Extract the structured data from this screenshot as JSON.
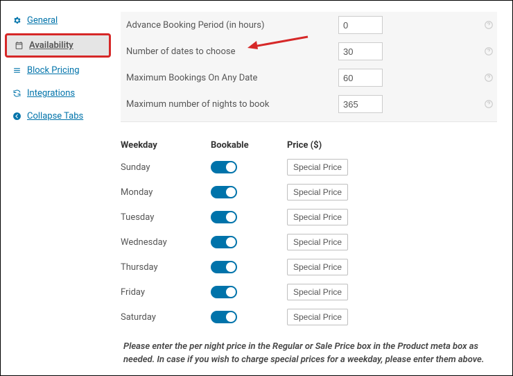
{
  "sidebar": {
    "items": [
      {
        "label": "General",
        "icon": "gear"
      },
      {
        "label": "Availability",
        "icon": "calendar"
      },
      {
        "label": "Block Pricing",
        "icon": "list"
      },
      {
        "label": "Integrations",
        "icon": "refresh"
      },
      {
        "label": "Collapse Tabs",
        "icon": "arrow-left"
      }
    ]
  },
  "settings": {
    "rows": [
      {
        "label": "Advance Booking Period (in hours)",
        "value": "0"
      },
      {
        "label": "Number of dates to choose",
        "value": "30"
      },
      {
        "label": "Maximum Bookings On Any Date",
        "value": "60"
      },
      {
        "label": "Maximum number of nights to book",
        "value": "365"
      }
    ]
  },
  "table": {
    "headers": {
      "weekday": "Weekday",
      "bookable": "Bookable",
      "price": "Price ($)"
    },
    "days": [
      {
        "name": "Sunday",
        "price_btn": "Special Price"
      },
      {
        "name": "Monday",
        "price_btn": "Special Price"
      },
      {
        "name": "Tuesday",
        "price_btn": "Special Price"
      },
      {
        "name": "Wednesday",
        "price_btn": "Special Price"
      },
      {
        "name": "Thursday",
        "price_btn": "Special Price"
      },
      {
        "name": "Friday",
        "price_btn": "Special Price"
      },
      {
        "name": "Saturday",
        "price_btn": "Special Price"
      }
    ]
  },
  "note": "Please enter the per night price in the Regular or Sale Price box in the Product meta box as needed. In case if you wish to charge special prices for a weekday, please enter them above."
}
